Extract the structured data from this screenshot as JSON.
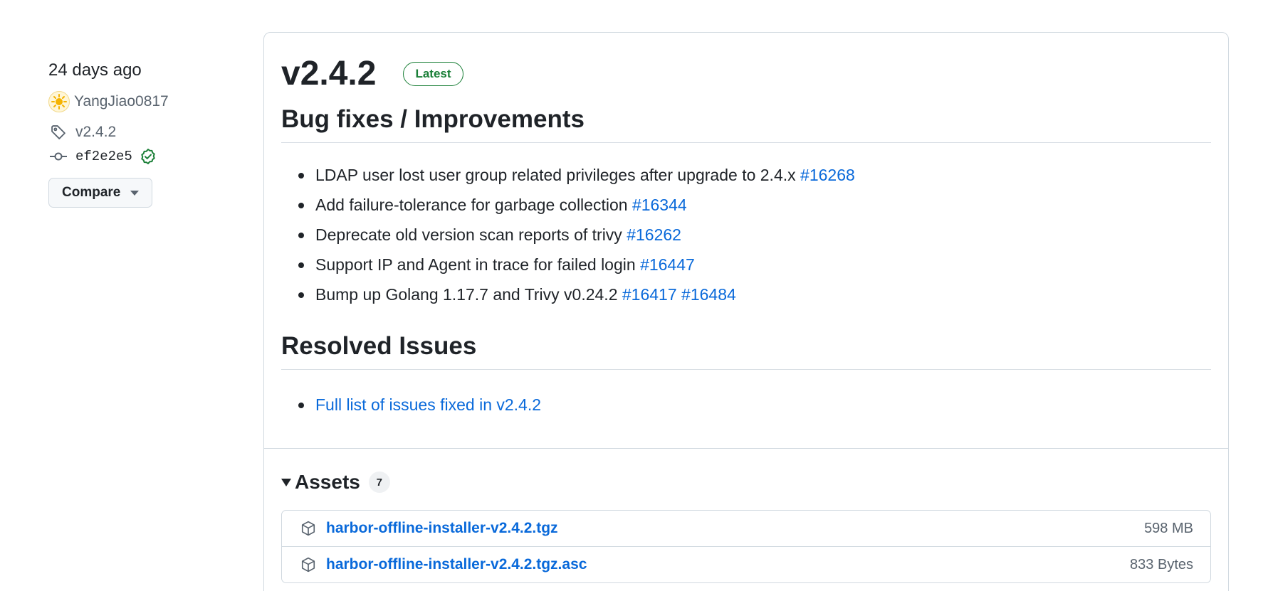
{
  "meta": {
    "date": "24 days ago",
    "author": "YangJiao0817",
    "tag": "v2.4.2",
    "commit": "ef2e2e5",
    "compare_label": "Compare",
    "icons": {
      "avatar": "sun-avatar-icon",
      "tag": "tag-icon",
      "commit": "git-commit-icon",
      "verified": "verified-check-icon",
      "compare_caret": "triangle-down-icon"
    }
  },
  "release": {
    "title": "v2.4.2",
    "badge": "Latest",
    "sections": [
      {
        "heading": "Bug fixes / Improvements",
        "items": [
          {
            "text": "LDAP user lost user group related privileges after upgrade to 2.4.x",
            "links": [
              "#16268"
            ]
          },
          {
            "text": "Add failure-tolerance for garbage collection",
            "links": [
              "#16344"
            ]
          },
          {
            "text": "Deprecate old version scan reports of trivy",
            "links": [
              "#16262"
            ]
          },
          {
            "text": "Support IP and Agent in trace for failed login",
            "links": [
              "#16447"
            ]
          },
          {
            "text": "Bump up Golang 1.17.7 and Trivy v0.24.2",
            "links": [
              "#16417",
              "#16484"
            ]
          }
        ]
      },
      {
        "heading": "Resolved Issues",
        "link_item": "Full list of issues fixed in v2.4.2"
      }
    ]
  },
  "assets": {
    "title": "Assets",
    "count": "7",
    "items": [
      {
        "name": "harbor-offline-installer-v2.4.2.tgz",
        "size": "598 MB",
        "icon": "package-icon"
      },
      {
        "name": "harbor-offline-installer-v2.4.2.tgz.asc",
        "size": "833 Bytes",
        "icon": "package-icon"
      }
    ]
  },
  "colors": {
    "link": "#0969da",
    "latest_badge": "#1a7f37",
    "verified": "#1a7f37",
    "text": "#1f2328",
    "muted": "#59636e",
    "border": "#d1d9e0"
  }
}
